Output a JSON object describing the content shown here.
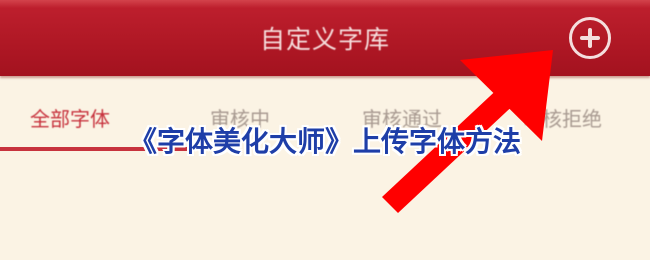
{
  "header": {
    "title": "自定义字库",
    "add_icon": "plus-circle-icon"
  },
  "tabs": [
    {
      "label": "全部字体",
      "active": true
    },
    {
      "label": "审核中",
      "active": false
    },
    {
      "label": "审核通过",
      "active": false
    },
    {
      "label": "审核拒绝",
      "active": false
    }
  ],
  "overlay": {
    "title": "《字体美化大师》上传字体方法"
  },
  "annotation": {
    "arrow_icon": "red-arrow-pointer-icon",
    "arrow_color": "#ff0000"
  },
  "colors": {
    "header_red": "#b01825",
    "accent_red": "#c7323d",
    "background": "#fbf3e4",
    "overlay_blue": "#1e3ea8"
  }
}
